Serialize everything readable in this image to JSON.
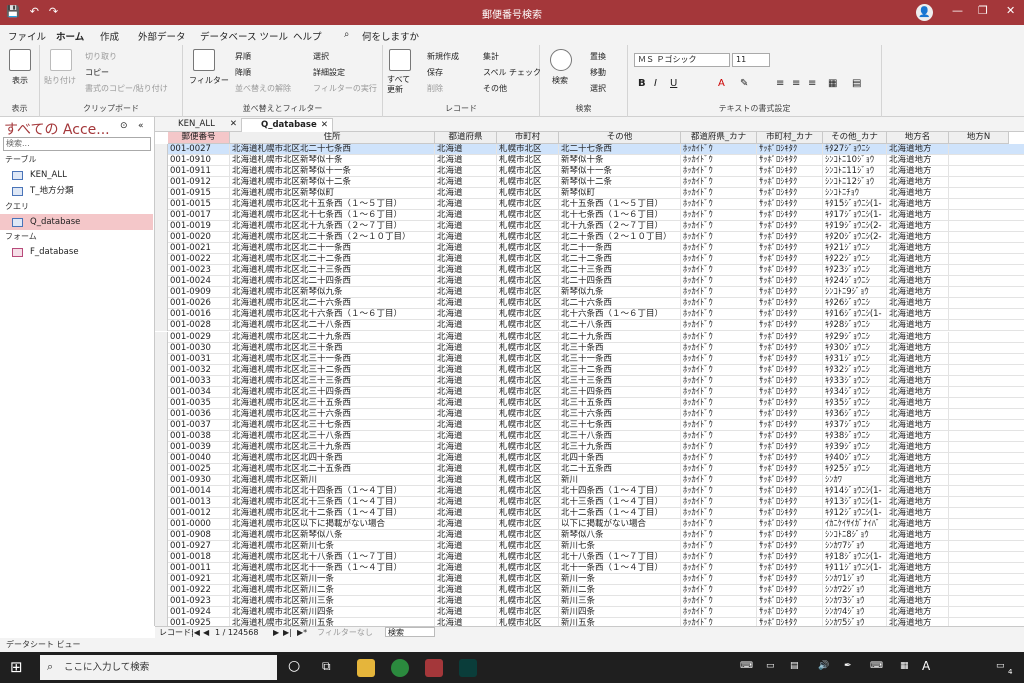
{
  "titlebar": {
    "title": "郵便番号検索",
    "save_icon": "💾",
    "undo_icon": "↶",
    "redo_icon": "↷",
    "account_icon": "👤",
    "min": "—",
    "max": "❐",
    "close": "✕"
  },
  "tabs": [
    "ファイル",
    "ホーム",
    "作成",
    "外部データ",
    "データベース ツール",
    "ヘルプ"
  ],
  "tell_me": "何をしますか",
  "ribbon": {
    "view": {
      "btn": "表示",
      "label": "表示"
    },
    "clipboard": {
      "paste": "貼り付け",
      "cut": "切り取り",
      "copy": "コピー",
      "format_painter": "書式のコピー/貼り付け",
      "label": "クリップボード"
    },
    "sort": {
      "filter": "フィルター",
      "asc": "昇順",
      "desc": "降順",
      "clear": "並べ替えの解除",
      "select": "選択",
      "advanced": "詳細設定",
      "toggle": "フィルターの実行",
      "label": "並べ替えとフィルター"
    },
    "records": {
      "refresh": "すべて\n更新",
      "new": "新規作成",
      "save": "保存",
      "delete": "削除",
      "totals": "集計",
      "spell": "スペル チェック",
      "more": "その他",
      "label": "レコード"
    },
    "find": {
      "find": "検索",
      "replace": "置換",
      "goto": "移動",
      "select": "選択",
      "label": "検索"
    },
    "text": {
      "font": "ＭＳ Ｐゴシック",
      "size": "11",
      "label": "テキストの書式設定"
    }
  },
  "nav": {
    "header": "すべての Acce...",
    "search": "検索...",
    "sec_table": "テーブル",
    "sec_query": "クエリ",
    "sec_form": "フォーム",
    "items": [
      "KEN_ALL",
      "T_地方分類",
      "Q_database",
      "F_database"
    ]
  },
  "doctabs": [
    "KEN_ALL",
    "Q_database"
  ],
  "columns": [
    "郵便番号",
    "住所",
    "都道府県",
    "市町村",
    "その他",
    "都道府県_カナ",
    "市町村_カナ",
    "その他_カナ",
    "地方名",
    "地方N"
  ],
  "rows": [
    [
      "001-0027",
      "北海道札幌市北区北二十七条西",
      "北海道",
      "札幌市北区",
      "北二十七条西",
      "ﾎｯｶｲﾄﾞｳ",
      "ｻｯﾎﾟﾛｼｷﾀｸ",
      "ｷﾀ27ｼﾞｮｳﾆｼ",
      "北海道地方"
    ],
    [
      "001-0910",
      "北海道札幌市北区新琴似十条",
      "北海道",
      "札幌市北区",
      "新琴似十条",
      "ﾎｯｶｲﾄﾞｳ",
      "ｻｯﾎﾟﾛｼｷﾀｸ",
      "ｼﾝｺﾄﾆ10ｼﾞｮｳ",
      "北海道地方"
    ],
    [
      "001-0911",
      "北海道札幌市北区新琴似十一条",
      "北海道",
      "札幌市北区",
      "新琴似十一条",
      "ﾎｯｶｲﾄﾞｳ",
      "ｻｯﾎﾟﾛｼｷﾀｸ",
      "ｼﾝｺﾄﾆ11ｼﾞｮｳ",
      "北海道地方"
    ],
    [
      "001-0912",
      "北海道札幌市北区新琴似十二条",
      "北海道",
      "札幌市北区",
      "新琴似十二条",
      "ﾎｯｶｲﾄﾞｳ",
      "ｻｯﾎﾟﾛｼｷﾀｸ",
      "ｼﾝｺﾄﾆ12ｼﾞｮｳ",
      "北海道地方"
    ],
    [
      "001-0915",
      "北海道札幌市北区新琴似町",
      "北海道",
      "札幌市北区",
      "新琴似町",
      "ﾎｯｶｲﾄﾞｳ",
      "ｻｯﾎﾟﾛｼｷﾀｸ",
      "ｼﾝｺﾄﾆﾁｮｳ",
      "北海道地方"
    ],
    [
      "001-0015",
      "北海道札幌市北区北十五条西（１～５丁目）",
      "北海道",
      "札幌市北区",
      "北十五条西（１～５丁目）",
      "ﾎｯｶｲﾄﾞｳ",
      "ｻｯﾎﾟﾛｼｷﾀｸ",
      "ｷﾀ15ｼﾞｮｳﾆｼ(1-",
      "北海道地方"
    ],
    [
      "001-0017",
      "北海道札幌市北区北十七条西（１～６丁目）",
      "北海道",
      "札幌市北区",
      "北十七条西（１～６丁目）",
      "ﾎｯｶｲﾄﾞｳ",
      "ｻｯﾎﾟﾛｼｷﾀｸ",
      "ｷﾀ17ｼﾞｮｳﾆｼ(1-",
      "北海道地方"
    ],
    [
      "001-0019",
      "北海道札幌市北区北十九条西（２～７丁目）",
      "北海道",
      "札幌市北区",
      "北十九条西（２～７丁目）",
      "ﾎｯｶｲﾄﾞｳ",
      "ｻｯﾎﾟﾛｼｷﾀｸ",
      "ｷﾀ19ｼﾞｮｳﾆｼ(2-",
      "北海道地方"
    ],
    [
      "001-0020",
      "北海道札幌市北区北二十条西（２～１０丁目）",
      "北海道",
      "札幌市北区",
      "北二十条西（２～１０丁目）",
      "ﾎｯｶｲﾄﾞｳ",
      "ｻｯﾎﾟﾛｼｷﾀｸ",
      "ｷﾀ20ｼﾞｮｳﾆｼ(2-",
      "北海道地方"
    ],
    [
      "001-0021",
      "北海道札幌市北区北二十一条西",
      "北海道",
      "札幌市北区",
      "北二十一条西",
      "ﾎｯｶｲﾄﾞｳ",
      "ｻｯﾎﾟﾛｼｷﾀｸ",
      "ｷﾀ21ｼﾞｮｳﾆｼ",
      "北海道地方"
    ],
    [
      "001-0022",
      "北海道札幌市北区北二十二条西",
      "北海道",
      "札幌市北区",
      "北二十二条西",
      "ﾎｯｶｲﾄﾞｳ",
      "ｻｯﾎﾟﾛｼｷﾀｸ",
      "ｷﾀ22ｼﾞｮｳﾆｼ",
      "北海道地方"
    ],
    [
      "001-0023",
      "北海道札幌市北区北二十三条西",
      "北海道",
      "札幌市北区",
      "北二十三条西",
      "ﾎｯｶｲﾄﾞｳ",
      "ｻｯﾎﾟﾛｼｷﾀｸ",
      "ｷﾀ23ｼﾞｮｳﾆｼ",
      "北海道地方"
    ],
    [
      "001-0024",
      "北海道札幌市北区北二十四条西",
      "北海道",
      "札幌市北区",
      "北二十四条西",
      "ﾎｯｶｲﾄﾞｳ",
      "ｻｯﾎﾟﾛｼｷﾀｸ",
      "ｷﾀ24ｼﾞｮｳﾆｼ",
      "北海道地方"
    ],
    [
      "001-0909",
      "北海道札幌市北区新琴似九条",
      "北海道",
      "札幌市北区",
      "新琴似九条",
      "ﾎｯｶｲﾄﾞｳ",
      "ｻｯﾎﾟﾛｼｷﾀｸ",
      "ｼﾝｺﾄﾆ9ｼﾞｮｳ",
      "北海道地方"
    ],
    [
      "001-0026",
      "北海道札幌市北区北二十六条西",
      "北海道",
      "札幌市北区",
      "北二十六条西",
      "ﾎｯｶｲﾄﾞｳ",
      "ｻｯﾎﾟﾛｼｷﾀｸ",
      "ｷﾀ26ｼﾞｮｳﾆｼ",
      "北海道地方"
    ],
    [
      "001-0016",
      "北海道札幌市北区北十六条西（１～６丁目）",
      "北海道",
      "札幌市北区",
      "北十六条西（１～６丁目）",
      "ﾎｯｶｲﾄﾞｳ",
      "ｻｯﾎﾟﾛｼｷﾀｸ",
      "ｷﾀ16ｼﾞｮｳﾆｼ(1-",
      "北海道地方"
    ],
    [
      "001-0028",
      "北海道札幌市北区北二十八条西",
      "北海道",
      "札幌市北区",
      "北二十八条西",
      "ﾎｯｶｲﾄﾞｳ",
      "ｻｯﾎﾟﾛｼｷﾀｸ",
      "ｷﾀ28ｼﾞｮｳﾆｼ",
      "北海道地方"
    ],
    [
      "001-0029",
      "北海道札幌市北区北二十九条西",
      "北海道",
      "札幌市北区",
      "北二十九条西",
      "ﾎｯｶｲﾄﾞｳ",
      "ｻｯﾎﾟﾛｼｷﾀｸ",
      "ｷﾀ29ｼﾞｮｳﾆｼ",
      "北海道地方"
    ],
    [
      "001-0030",
      "北海道札幌市北区北三十条西",
      "北海道",
      "札幌市北区",
      "北三十条西",
      "ﾎｯｶｲﾄﾞｳ",
      "ｻｯﾎﾟﾛｼｷﾀｸ",
      "ｷﾀ30ｼﾞｮｳﾆｼ",
      "北海道地方"
    ],
    [
      "001-0031",
      "北海道札幌市北区北三十一条西",
      "北海道",
      "札幌市北区",
      "北三十一条西",
      "ﾎｯｶｲﾄﾞｳ",
      "ｻｯﾎﾟﾛｼｷﾀｸ",
      "ｷﾀ31ｼﾞｮｳﾆｼ",
      "北海道地方"
    ],
    [
      "001-0032",
      "北海道札幌市北区北三十二条西",
      "北海道",
      "札幌市北区",
      "北三十二条西",
      "ﾎｯｶｲﾄﾞｳ",
      "ｻｯﾎﾟﾛｼｷﾀｸ",
      "ｷﾀ32ｼﾞｮｳﾆｼ",
      "北海道地方"
    ],
    [
      "001-0033",
      "北海道札幌市北区北三十三条西",
      "北海道",
      "札幌市北区",
      "北三十三条西",
      "ﾎｯｶｲﾄﾞｳ",
      "ｻｯﾎﾟﾛｼｷﾀｸ",
      "ｷﾀ33ｼﾞｮｳﾆｼ",
      "北海道地方"
    ],
    [
      "001-0034",
      "北海道札幌市北区北三十四条西",
      "北海道",
      "札幌市北区",
      "北三十四条西",
      "ﾎｯｶｲﾄﾞｳ",
      "ｻｯﾎﾟﾛｼｷﾀｸ",
      "ｷﾀ34ｼﾞｮｳﾆｼ",
      "北海道地方"
    ],
    [
      "001-0035",
      "北海道札幌市北区北三十五条西",
      "北海道",
      "札幌市北区",
      "北三十五条西",
      "ﾎｯｶｲﾄﾞｳ",
      "ｻｯﾎﾟﾛｼｷﾀｸ",
      "ｷﾀ35ｼﾞｮｳﾆｼ",
      "北海道地方"
    ],
    [
      "001-0036",
      "北海道札幌市北区北三十六条西",
      "北海道",
      "札幌市北区",
      "北三十六条西",
      "ﾎｯｶｲﾄﾞｳ",
      "ｻｯﾎﾟﾛｼｷﾀｸ",
      "ｷﾀ36ｼﾞｮｳﾆｼ",
      "北海道地方"
    ],
    [
      "001-0037",
      "北海道札幌市北区北三十七条西",
      "北海道",
      "札幌市北区",
      "北三十七条西",
      "ﾎｯｶｲﾄﾞｳ",
      "ｻｯﾎﾟﾛｼｷﾀｸ",
      "ｷﾀ37ｼﾞｮｳﾆｼ",
      "北海道地方"
    ],
    [
      "001-0038",
      "北海道札幌市北区北三十八条西",
      "北海道",
      "札幌市北区",
      "北三十八条西",
      "ﾎｯｶｲﾄﾞｳ",
      "ｻｯﾎﾟﾛｼｷﾀｸ",
      "ｷﾀ38ｼﾞｮｳﾆｼ",
      "北海道地方"
    ],
    [
      "001-0039",
      "北海道札幌市北区北三十九条西",
      "北海道",
      "札幌市北区",
      "北三十九条西",
      "ﾎｯｶｲﾄﾞｳ",
      "ｻｯﾎﾟﾛｼｷﾀｸ",
      "ｷﾀ39ｼﾞｮｳﾆｼ",
      "北海道地方"
    ],
    [
      "001-0040",
      "北海道札幌市北区北四十条西",
      "北海道",
      "札幌市北区",
      "北四十条西",
      "ﾎｯｶｲﾄﾞｳ",
      "ｻｯﾎﾟﾛｼｷﾀｸ",
      "ｷﾀ40ｼﾞｮｳﾆｼ",
      "北海道地方"
    ],
    [
      "001-0025",
      "北海道札幌市北区北二十五条西",
      "北海道",
      "札幌市北区",
      "北二十五条西",
      "ﾎｯｶｲﾄﾞｳ",
      "ｻｯﾎﾟﾛｼｷﾀｸ",
      "ｷﾀ25ｼﾞｮｳﾆｼ",
      "北海道地方"
    ],
    [
      "001-0930",
      "北海道札幌市北区新川",
      "北海道",
      "札幌市北区",
      "新川",
      "ﾎｯｶｲﾄﾞｳ",
      "ｻｯﾎﾟﾛｼｷﾀｸ",
      "ｼﾝｶﾜ",
      "北海道地方"
    ],
    [
      "001-0014",
      "北海道札幌市北区北十四条西（１～４丁目）",
      "北海道",
      "札幌市北区",
      "北十四条西（１～４丁目）",
      "ﾎｯｶｲﾄﾞｳ",
      "ｻｯﾎﾟﾛｼｷﾀｸ",
      "ｷﾀ14ｼﾞｮｳﾆｼ(1-",
      "北海道地方"
    ],
    [
      "001-0013",
      "北海道札幌市北区北十三条西（１～４丁目）",
      "北海道",
      "札幌市北区",
      "北十三条西（１～４丁目）",
      "ﾎｯｶｲﾄﾞｳ",
      "ｻｯﾎﾟﾛｼｷﾀｸ",
      "ｷﾀ13ｼﾞｮｳﾆｼ(1-",
      "北海道地方"
    ],
    [
      "001-0012",
      "北海道札幌市北区北十二条西（１～４丁目）",
      "北海道",
      "札幌市北区",
      "北十二条西（１～４丁目）",
      "ﾎｯｶｲﾄﾞｳ",
      "ｻｯﾎﾟﾛｼｷﾀｸ",
      "ｷﾀ12ｼﾞｮｳﾆｼ(1-",
      "北海道地方"
    ],
    [
      "001-0000",
      "北海道札幌市北区以下に掲載がない場合",
      "北海道",
      "札幌市北区",
      "以下に掲載がない場合",
      "ﾎｯｶｲﾄﾞｳ",
      "ｻｯﾎﾟﾛｼｷﾀｸ",
      "ｲｶﾆｹｲｻｲｶﾞﾅｲﾊﾞ",
      "北海道地方"
    ],
    [
      "001-0908",
      "北海道札幌市北区新琴似八条",
      "北海道",
      "札幌市北区",
      "新琴似八条",
      "ﾎｯｶｲﾄﾞｳ",
      "ｻｯﾎﾟﾛｼｷﾀｸ",
      "ｼﾝｺﾄﾆ8ｼﾞｮｳ",
      "北海道地方"
    ],
    [
      "001-0927",
      "北海道札幌市北区新川七条",
      "北海道",
      "札幌市北区",
      "新川七条",
      "ﾎｯｶｲﾄﾞｳ",
      "ｻｯﾎﾟﾛｼｷﾀｸ",
      "ｼﾝｶﾜ7ｼﾞｮｳ",
      "北海道地方"
    ],
    [
      "001-0018",
      "北海道札幌市北区北十八条西（１～７丁目）",
      "北海道",
      "札幌市北区",
      "北十八条西（１～７丁目）",
      "ﾎｯｶｲﾄﾞｳ",
      "ｻｯﾎﾟﾛｼｷﾀｸ",
      "ｷﾀ18ｼﾞｮｳﾆｼ(1-",
      "北海道地方"
    ],
    [
      "001-0011",
      "北海道札幌市北区北十一条西（１～４丁目）",
      "北海道",
      "札幌市北区",
      "北十一条西（１～４丁目）",
      "ﾎｯｶｲﾄﾞｳ",
      "ｻｯﾎﾟﾛｼｷﾀｸ",
      "ｷﾀ11ｼﾞｮｳﾆｼ(1-",
      "北海道地方"
    ],
    [
      "001-0921",
      "北海道札幌市北区新川一条",
      "北海道",
      "札幌市北区",
      "新川一条",
      "ﾎｯｶｲﾄﾞｳ",
      "ｻｯﾎﾟﾛｼｷﾀｸ",
      "ｼﾝｶﾜ1ｼﾞｮｳ",
      "北海道地方"
    ],
    [
      "001-0922",
      "北海道札幌市北区新川二条",
      "北海道",
      "札幌市北区",
      "新川二条",
      "ﾎｯｶｲﾄﾞｳ",
      "ｻｯﾎﾟﾛｼｷﾀｸ",
      "ｼﾝｶﾜ2ｼﾞｮｳ",
      "北海道地方"
    ],
    [
      "001-0923",
      "北海道札幌市北区新川三条",
      "北海道",
      "札幌市北区",
      "新川三条",
      "ﾎｯｶｲﾄﾞｳ",
      "ｻｯﾎﾟﾛｼｷﾀｸ",
      "ｼﾝｶﾜ3ｼﾞｮｳ",
      "北海道地方"
    ],
    [
      "001-0924",
      "北海道札幌市北区新川四条",
      "北海道",
      "札幌市北区",
      "新川四条",
      "ﾎｯｶｲﾄﾞｳ",
      "ｻｯﾎﾟﾛｼｷﾀｸ",
      "ｼﾝｶﾜ4ｼﾞｮｳ",
      "北海道地方"
    ],
    [
      "001-0925",
      "北海道札幌市北区新川五条",
      "北海道",
      "札幌市北区",
      "新川五条",
      "ﾎｯｶｲﾄﾞｳ",
      "ｻｯﾎﾟﾛｼｷﾀｸ",
      "ｼﾝｶﾜ5ｼﾞｮｳ",
      "北海道地方"
    ]
  ],
  "recbar": {
    "label": "レコード:",
    "pos": "1 / 124568",
    "filter": "フィルターなし",
    "search": "検索",
    "nav_first": "|◀",
    "nav_prev": "◀",
    "nav_next": "▶",
    "nav_last": "▶|",
    "nav_new": "▶*"
  },
  "status": "データシート ビュー",
  "taskbar": {
    "search": "ここに入力して検索",
    "ime": "A",
    "notif": "4"
  },
  "colors": {
    "accent": "#a4373a",
    "selected_nav": "#f4c7c9",
    "selected_row": "#cfe3fb"
  }
}
